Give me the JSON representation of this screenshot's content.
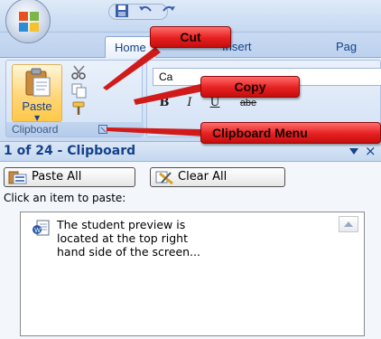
{
  "ribbon": {
    "tabs": [
      "Home",
      "Insert",
      "Pag"
    ],
    "clipboard_group_label": "Clipboard",
    "paste_label": "Paste",
    "font_box_value": "Ca",
    "format_buttons": [
      "B",
      "I",
      "U",
      "abe"
    ]
  },
  "callouts": {
    "cut": "Cut",
    "copy": "Copy",
    "clipboard_menu": "Clipboard Menu"
  },
  "pane": {
    "title": "1 of 24 - Clipboard",
    "close_glyph": "×",
    "paste_all_label": "Paste All",
    "clear_all_label": "Clear All",
    "hint": "Click an item to paste:",
    "items": [
      {
        "text": "The student preview is\nlocated at the top right\nhand side of the screen..."
      }
    ]
  },
  "colors": {
    "callout_red": "#e62020",
    "ribbon_blue": "#15428b"
  }
}
